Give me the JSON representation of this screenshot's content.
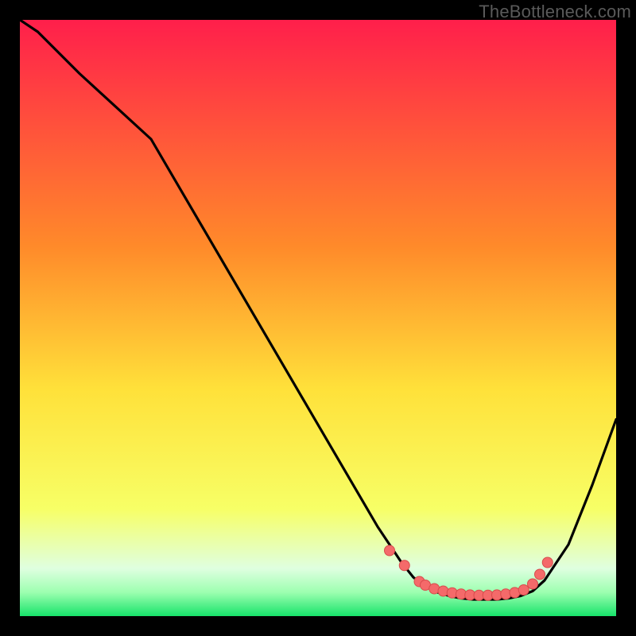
{
  "watermark": "TheBottleneck.com",
  "colors": {
    "curve": "#000000",
    "marker_fill": "#f46a6a",
    "marker_stroke": "#d84c4c",
    "grad_top": "#ff1f4b",
    "grad_mid_upper": "#ff8a2a",
    "grad_mid": "#ffe13a",
    "grad_mid_lower": "#f7ff66",
    "grad_green_light": "#9dffb0",
    "grad_green": "#17e36a"
  },
  "chart_data": {
    "type": "line",
    "title": "",
    "xlabel": "",
    "ylabel": "",
    "xlim": [
      0,
      100
    ],
    "ylim": [
      0,
      100
    ],
    "grid": false,
    "legend": false,
    "series": [
      {
        "name": "bottleneck-curve",
        "x": [
          0,
          3,
          6,
          10,
          22,
          60,
          64,
          66,
          68,
          70,
          72,
          74,
          76,
          78,
          80,
          82,
          84,
          86,
          88,
          92,
          96,
          100
        ],
        "y": [
          100,
          98,
          95,
          91,
          80,
          15,
          9,
          6.5,
          5,
          4,
          3.4,
          3,
          2.8,
          2.8,
          2.8,
          3,
          3.4,
          4.2,
          6,
          12,
          22,
          33
        ]
      }
    ],
    "markers": {
      "name": "highlight-points",
      "x": [
        62,
        64.5,
        67,
        68,
        69.5,
        71,
        72.5,
        74,
        75.5,
        77,
        78.5,
        80,
        81.5,
        83,
        84.5,
        86,
        87.2,
        88.5
      ],
      "y": [
        11,
        8.5,
        5.8,
        5.2,
        4.6,
        4.2,
        3.9,
        3.7,
        3.55,
        3.5,
        3.5,
        3.55,
        3.7,
        3.95,
        4.4,
        5.4,
        7,
        9
      ]
    }
  }
}
